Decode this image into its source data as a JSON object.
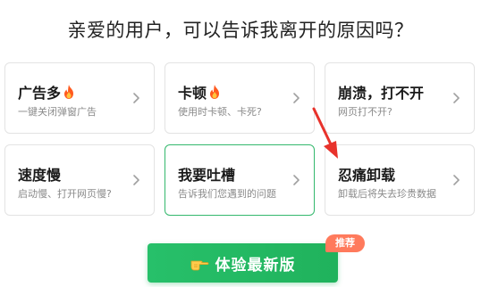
{
  "title": "亲爱的用户，可以告诉我离开的原因吗？",
  "options": [
    {
      "title": "广告多",
      "desc": "一键关闭弹窗广告",
      "icon": "fire-icon"
    },
    {
      "title": "卡顿",
      "desc": "使用时卡顿、卡死?",
      "icon": "fire-icon"
    },
    {
      "title": "崩溃，打不开",
      "desc": "网页打不开?"
    },
    {
      "title": "速度慢",
      "desc": "启动慢、打开网页慢?"
    },
    {
      "title": "我要吐槽",
      "desc": "告诉我们您遇到的问题"
    },
    {
      "title": "忍痛卸载",
      "desc": "卸载后将失去珍贵数据"
    }
  ],
  "cta": {
    "label": "体验最新版",
    "icon": "pointing-hand-icon"
  },
  "badge": {
    "label": "推荐"
  },
  "colors": {
    "accent": "#34b86d",
    "badge": "#ff7a5c",
    "arrow": "#e8322b"
  }
}
